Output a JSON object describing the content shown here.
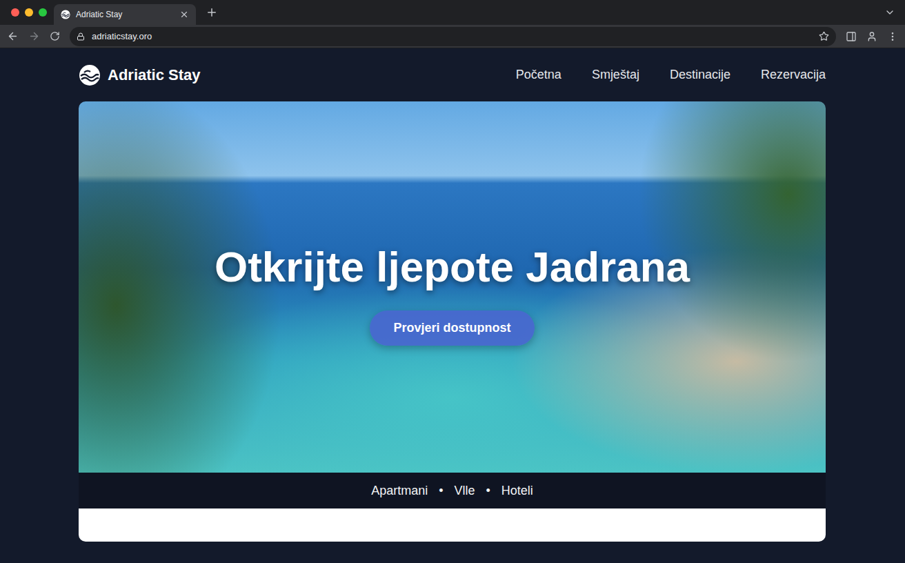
{
  "browser": {
    "tab_title": "Adriatic Stay",
    "url": "adriaticstay.oro"
  },
  "header": {
    "brand": "Adriatic Stay",
    "nav": [
      {
        "label": "Početna"
      },
      {
        "label": "Smještaj"
      },
      {
        "label": "Destinacije"
      },
      {
        "label": "Rezervacija"
      }
    ]
  },
  "hero": {
    "title": "Otkrijte ljepote Jadrana",
    "button": "Provjeri dostupnost"
  },
  "categories": {
    "items": [
      "Apartmani",
      "Vlle",
      "Hoteli"
    ],
    "separator": "•"
  }
}
